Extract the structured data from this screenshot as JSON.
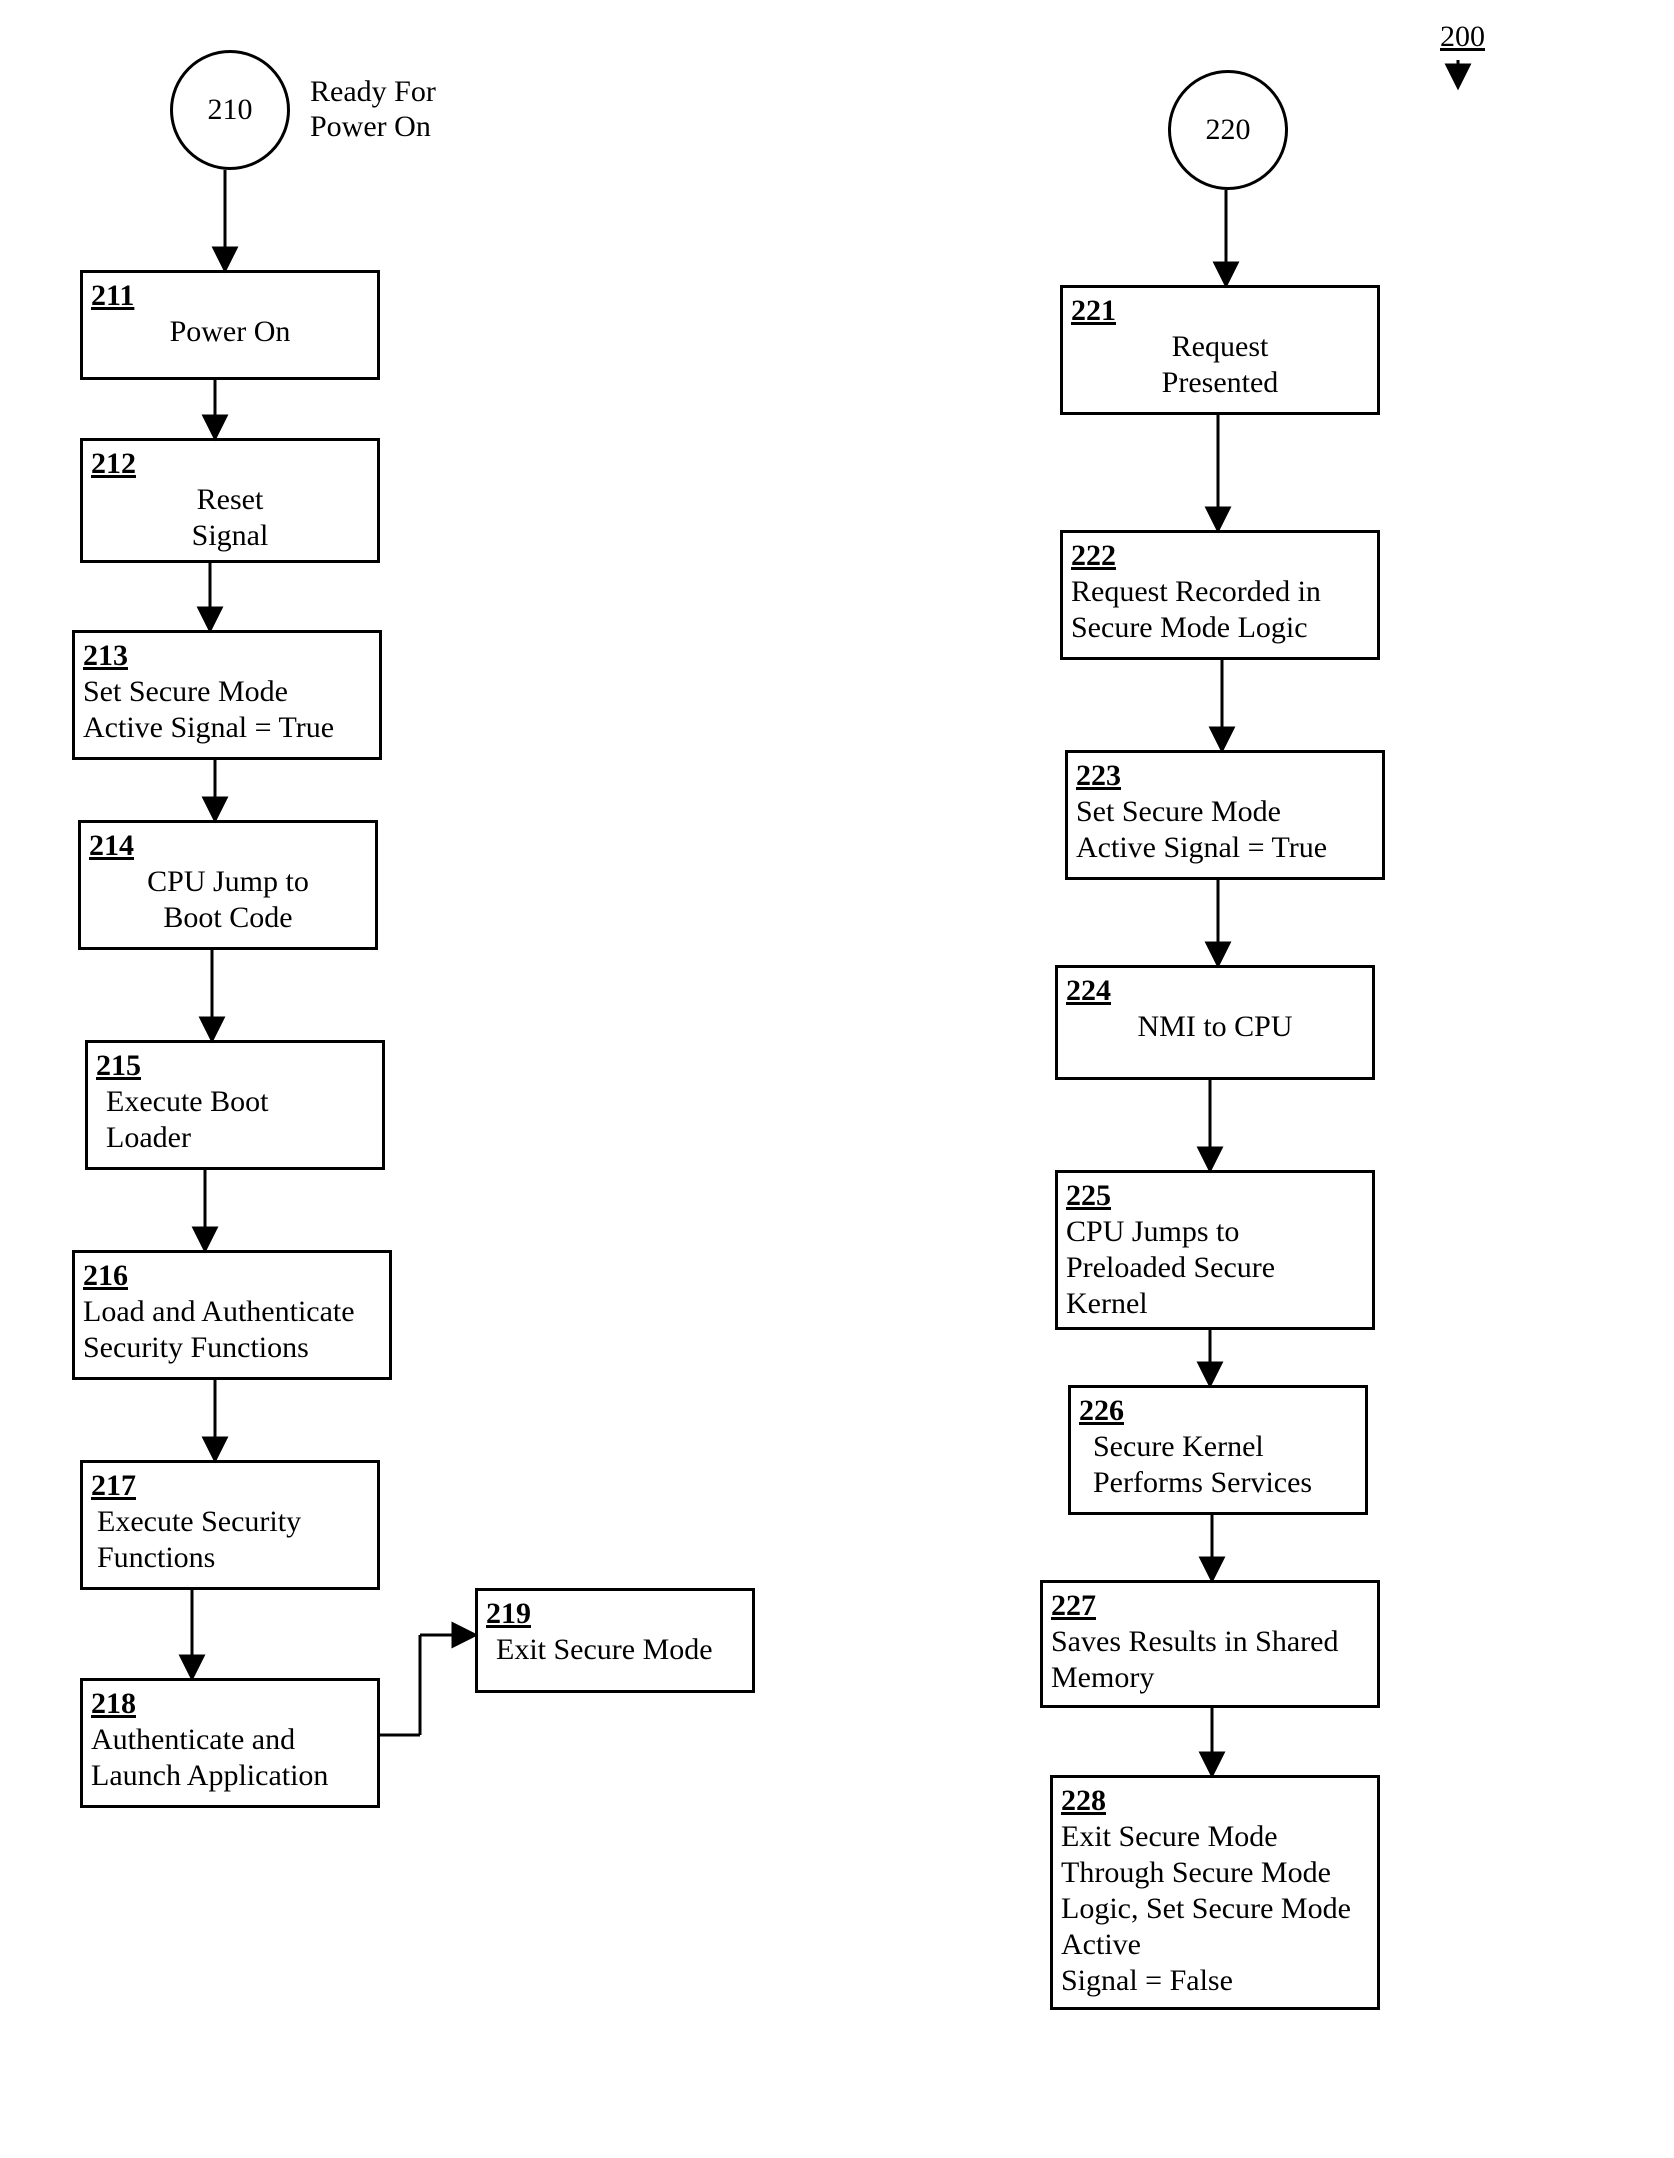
{
  "figure": {
    "ref_number": "200",
    "ready_label": "Ready For\nPower On"
  },
  "left": {
    "start_circle": "210",
    "n211": {
      "num": "211",
      "text": "Power On"
    },
    "n212": {
      "num": "212",
      "text": "Reset\nSignal"
    },
    "n213": {
      "num": "213",
      "text": "Set Secure Mode\nActive Signal = True"
    },
    "n214": {
      "num": "214",
      "text": "CPU Jump to\nBoot  Code"
    },
    "n215": {
      "num": "215",
      "text": "Execute Boot\nLoader"
    },
    "n216": {
      "num": "216",
      "text": "Load and Authenticate\nSecurity Functions"
    },
    "n217": {
      "num": "217",
      "text": "Execute Security\nFunctions"
    },
    "n218": {
      "num": "218",
      "text": "Authenticate and\nLaunch Application"
    },
    "n219": {
      "num": "219",
      "text": "Exit Secure Mode"
    }
  },
  "right": {
    "start_circle": "220",
    "n221": {
      "num": "221",
      "text": "Request\nPresented"
    },
    "n222": {
      "num": "222",
      "text": "Request Recorded in\nSecure Mode Logic"
    },
    "n223": {
      "num": "223",
      "text": "Set  Secure Mode\nActive Signal = True"
    },
    "n224": {
      "num": "224",
      "text": "NMI to CPU"
    },
    "n225": {
      "num": "225",
      "text": "CPU Jumps to\nPreloaded Secure\nKernel"
    },
    "n226": {
      "num": "226",
      "text": "Secure Kernel\nPerforms Services"
    },
    "n227": {
      "num": "227",
      "text": "Saves Results in Shared\nMemory"
    },
    "n228": {
      "num": "228",
      "text": "Exit Secure Mode\nThrough Secure Mode\nLogic, Set Secure Mode\nActive\n Signal = False"
    }
  }
}
